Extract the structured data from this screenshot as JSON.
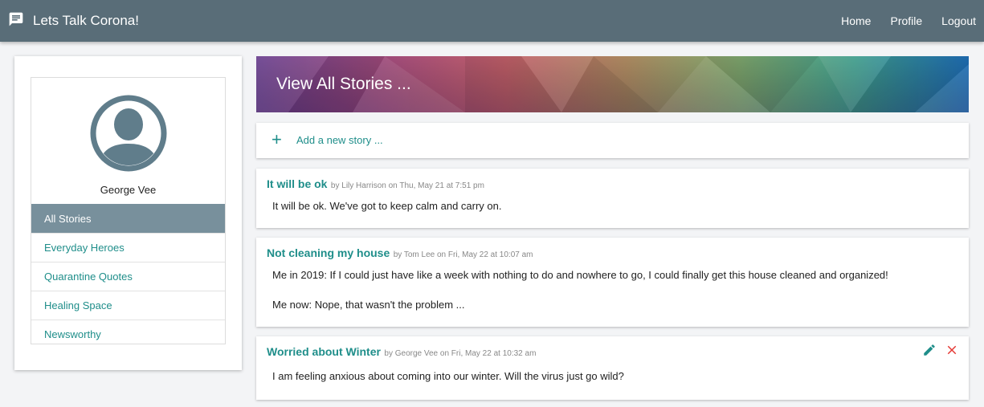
{
  "app": {
    "title": "Lets Talk Corona!"
  },
  "nav": {
    "home": "Home",
    "profile": "Profile",
    "logout": "Logout"
  },
  "profile": {
    "name": "George Vee"
  },
  "menu": [
    {
      "label": "All Stories",
      "active": true
    },
    {
      "label": "Everyday Heroes"
    },
    {
      "label": "Quarantine Quotes"
    },
    {
      "label": "Healing Space"
    },
    {
      "label": "Newsworthy"
    }
  ],
  "banner": {
    "title": "View All Stories ..."
  },
  "add_story": {
    "label": "Add a new story ..."
  },
  "stories": [
    {
      "title": "It will be ok",
      "meta": "by Lily Harrison on Thu, May 21 at 7:51 pm",
      "paragraphs": [
        "It will be ok. We've got to keep calm and carry on."
      ]
    },
    {
      "title": "Not cleaning my house",
      "meta": "by Tom Lee on Fri, May 22 at 10:07 am",
      "paragraphs": [
        "Me in 2019: If I could just have like a week with nothing to do and nowhere to go, I could finally get this house cleaned and organized!",
        "Me now: Nope, that wasn't the problem ..."
      ]
    },
    {
      "title": "Worried about Winter",
      "meta": "by George Vee on Fri, May 22 at 10:32 am",
      "paragraphs": [
        "I am feeling anxious about coming into our winter. Will the virus just go wild?"
      ],
      "actions": [
        "pencil-icon",
        "close-icon"
      ]
    }
  ],
  "colors": {
    "topbar": "#596d78",
    "accent": "#1f8e8a",
    "active_menu": "#78909c",
    "delete": "#e53935"
  }
}
